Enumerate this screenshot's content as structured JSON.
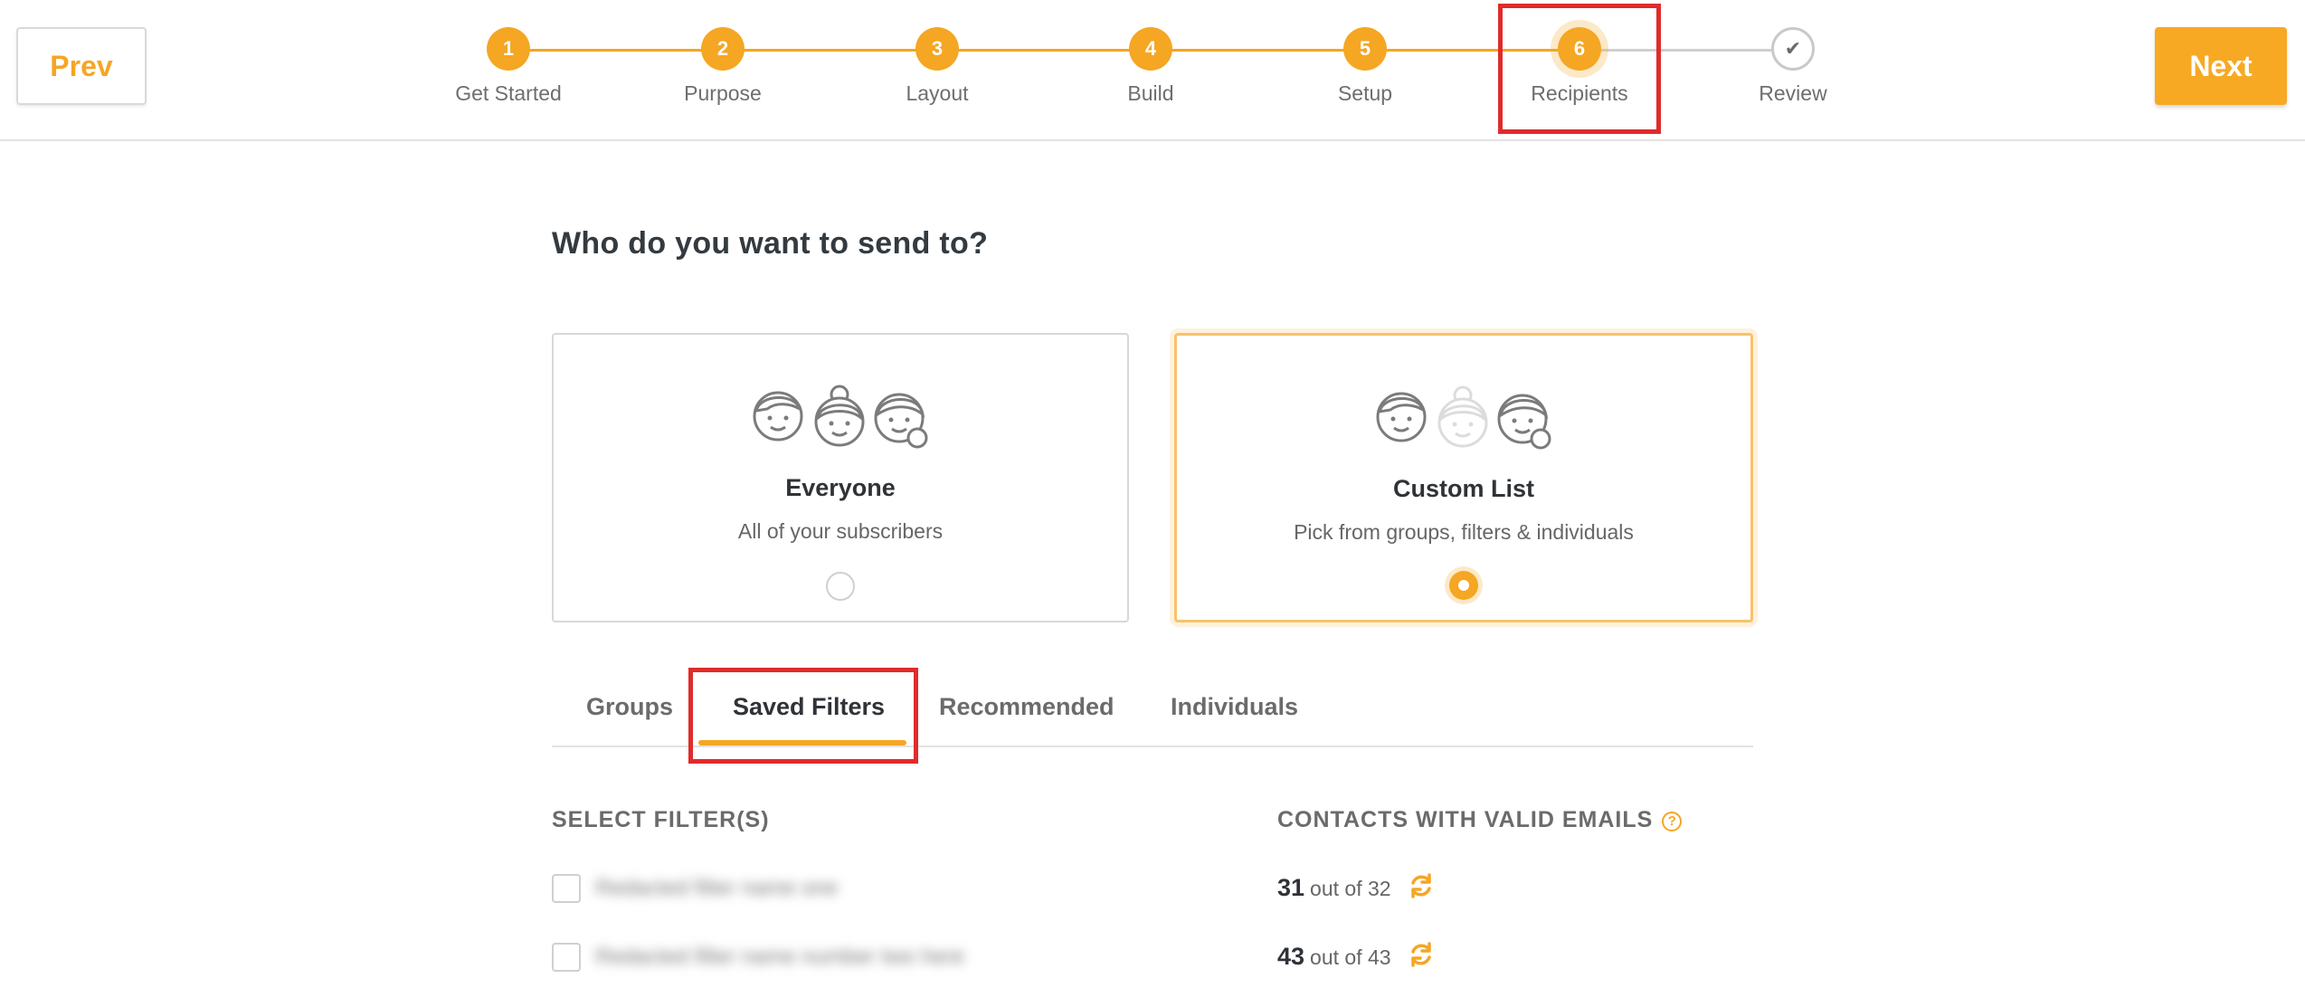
{
  "nav": {
    "prev_label": "Prev",
    "next_label": "Next"
  },
  "steps": [
    {
      "num": "1",
      "label": "Get Started"
    },
    {
      "num": "2",
      "label": "Purpose"
    },
    {
      "num": "3",
      "label": "Layout"
    },
    {
      "num": "4",
      "label": "Build"
    },
    {
      "num": "5",
      "label": "Setup"
    },
    {
      "num": "6",
      "label": "Recipients"
    },
    {
      "num": "✔",
      "label": "Review"
    }
  ],
  "current_step": 6,
  "question": "Who do you want to send to?",
  "options": {
    "everyone": {
      "title": "Everyone",
      "subtitle": "All of your subscribers",
      "selected": false
    },
    "custom": {
      "title": "Custom List",
      "subtitle": "Pick from groups, filters & individuals",
      "selected": true
    }
  },
  "tabs": [
    {
      "label": "Groups"
    },
    {
      "label": "Saved Filters",
      "active": true
    },
    {
      "label": "Recommended"
    },
    {
      "label": "Individuals"
    }
  ],
  "filters": {
    "select_header": "SELECT FILTER(S)",
    "contacts_header": "CONTACTS WITH VALID EMAILS",
    "help_glyph": "?",
    "rows": [
      {
        "name": "Redacted filter name one",
        "valid": "31",
        "total_text": "out of 32"
      },
      {
        "name": "Redacted filter name number two here",
        "valid": "43",
        "total_text": "out of 43"
      }
    ]
  },
  "colors": {
    "accent": "#f5a623",
    "highlight": "#e02b2b"
  }
}
